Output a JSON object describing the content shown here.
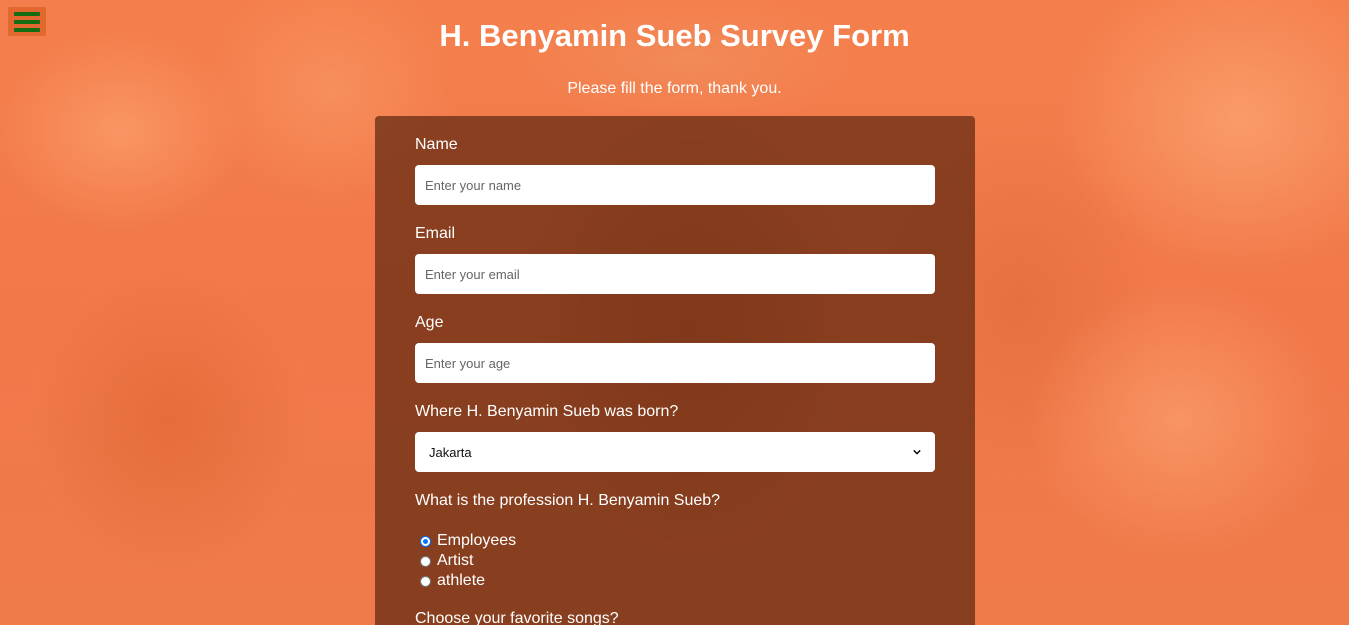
{
  "header": {
    "title": "H. Benyamin Sueb Survey Form",
    "subtitle": "Please fill the form, thank you."
  },
  "menu": {
    "icon": "hamburger-menu-icon",
    "color": "#156c12"
  },
  "form": {
    "name": {
      "label": "Name",
      "placeholder": "Enter your name",
      "value": ""
    },
    "email": {
      "label": "Email",
      "placeholder": "Enter your email",
      "value": ""
    },
    "age": {
      "label": "Age",
      "placeholder": "Enter your age",
      "value": ""
    },
    "birthplace": {
      "label": "Where H. Benyamin Sueb was born?",
      "selected": "Jakarta"
    },
    "profession": {
      "label": "What is the profession H. Benyamin Sueb?",
      "options": [
        {
          "label": "Employees",
          "checked": true
        },
        {
          "label": "Artist",
          "checked": false
        },
        {
          "label": "athlete",
          "checked": false
        }
      ]
    },
    "songs": {
      "label": "Choose your favorite songs?"
    }
  },
  "colors": {
    "background": "#f47f4c",
    "card": "#5f280f",
    "radio_accent": "#0075ff"
  }
}
